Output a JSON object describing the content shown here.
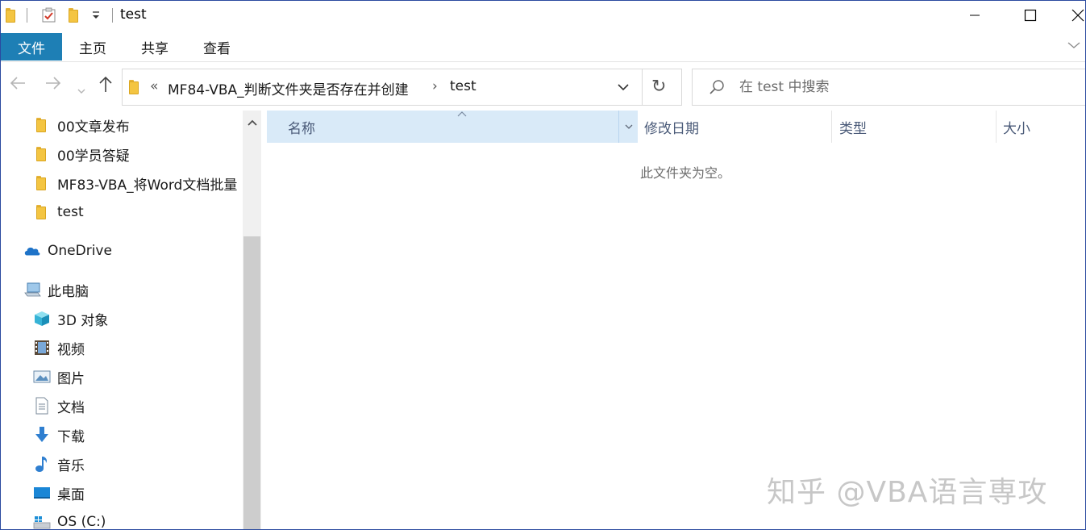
{
  "window": {
    "title": "test",
    "minimize_glyph": "—",
    "maximize_glyph": "☐",
    "close_glyph": "✕"
  },
  "ribbon": {
    "tabs": [
      {
        "label": "文件",
        "active": true
      },
      {
        "label": "主页"
      },
      {
        "label": "共享"
      },
      {
        "label": "查看"
      }
    ]
  },
  "address_bar": {
    "overflow": "«",
    "breadcrumbs": [
      {
        "label": "MF84-VBA_判断文件夹是否存在并创建"
      },
      {
        "label": "test"
      }
    ],
    "separator": "›",
    "refresh_glyph": "↻"
  },
  "search": {
    "placeholder": "在 test 中搜索"
  },
  "sidebar": {
    "quick_access_folders": [
      {
        "label": "00文章发布",
        "icon": "folder-icon"
      },
      {
        "label": "00学员答疑",
        "icon": "folder-icon"
      },
      {
        "label": "MF83-VBA_将Word文档批量",
        "icon": "folder-icon"
      },
      {
        "label": "test",
        "icon": "folder-icon"
      }
    ],
    "onedrive": {
      "label": "OneDrive",
      "icon": "cloud-icon"
    },
    "this_pc": {
      "label": "此电脑",
      "icon": "computer-icon"
    },
    "pc_items": [
      {
        "label": "3D 对象",
        "icon": "cube-icon"
      },
      {
        "label": "视频",
        "icon": "film-icon"
      },
      {
        "label": "图片",
        "icon": "picture-icon"
      },
      {
        "label": "文档",
        "icon": "document-icon"
      },
      {
        "label": "下载",
        "icon": "download-arrow-icon"
      },
      {
        "label": "音乐",
        "icon": "music-note-icon"
      },
      {
        "label": "桌面",
        "icon": "desktop-icon"
      },
      {
        "label": "OS (C:)",
        "icon": "drive-icon"
      }
    ]
  },
  "columns": [
    {
      "label": "名称"
    },
    {
      "label": "修改日期"
    },
    {
      "label": "类型"
    },
    {
      "label": "大小"
    }
  ],
  "content": {
    "empty_message": "此文件夹为空。"
  },
  "watermark": "知乎 @VBA语言専攻",
  "colors": {
    "file_tab": "#1e7fb5",
    "header_selected": "#d9eaf8",
    "folder_yellow": "#f4c542"
  }
}
